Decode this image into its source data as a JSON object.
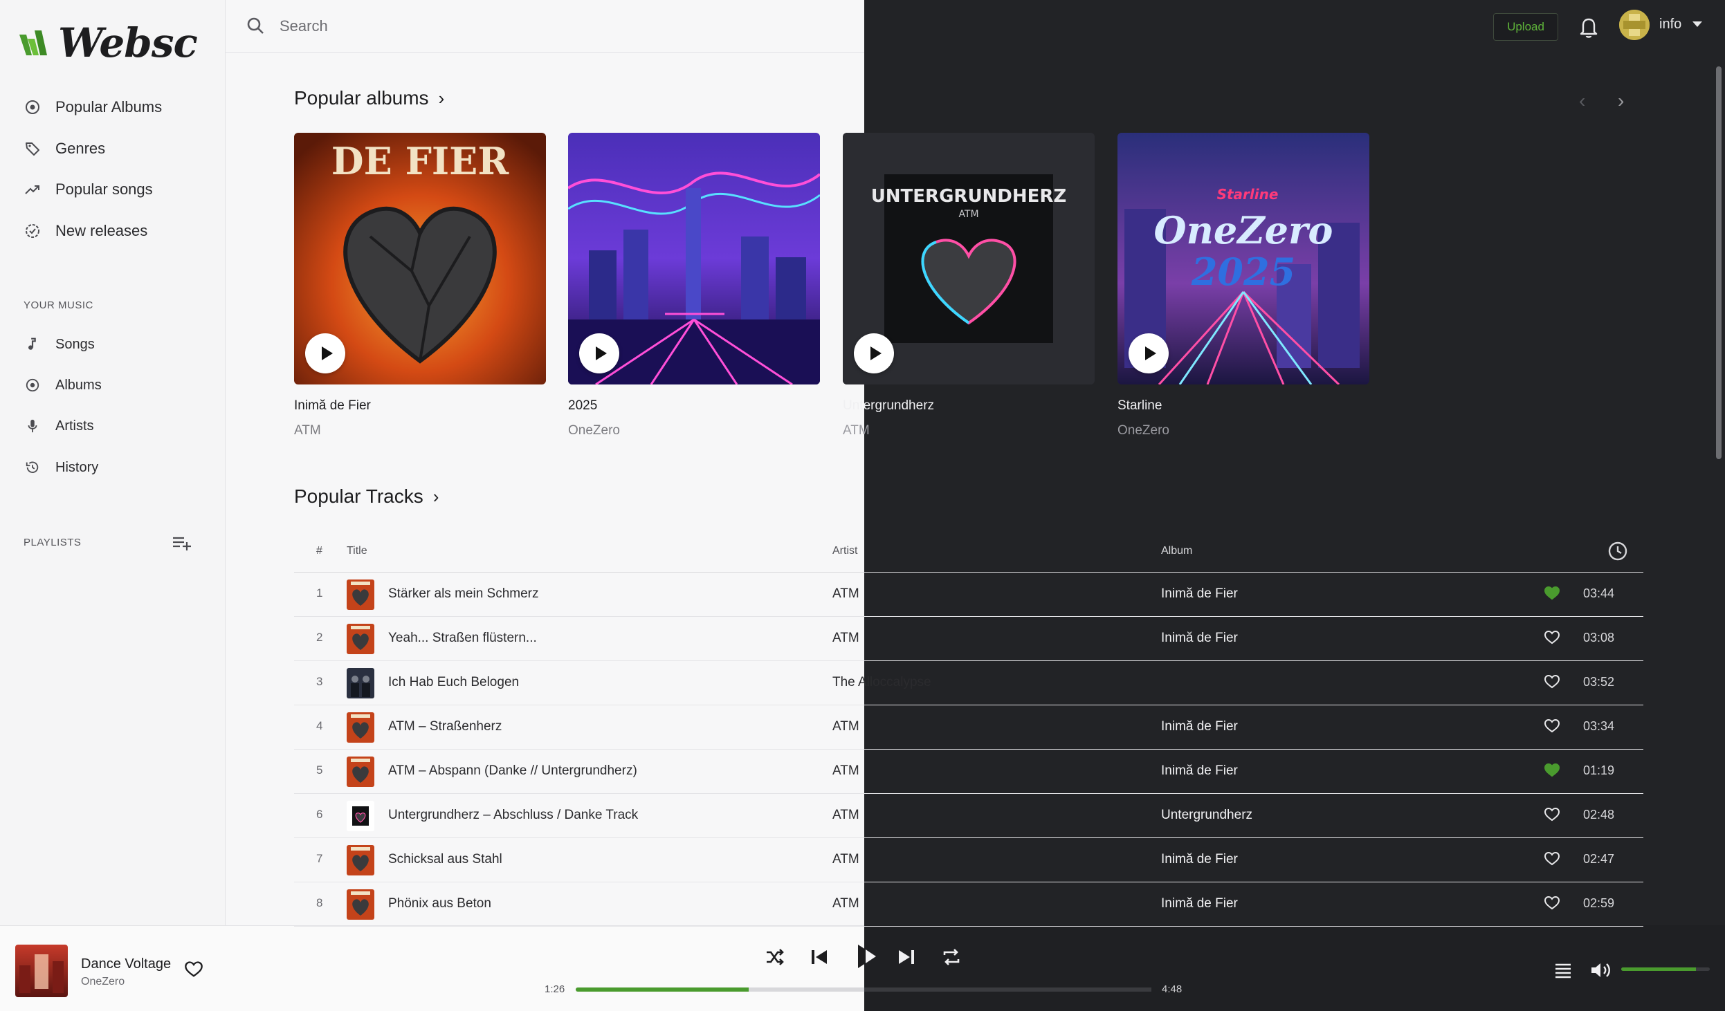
{
  "app": {
    "logo_text": "Websc"
  },
  "sidebar": {
    "main_items": [
      {
        "label": "Popular Albums",
        "icon": "disc-icon"
      },
      {
        "label": "Genres",
        "icon": "tag-icon"
      },
      {
        "label": "Popular songs",
        "icon": "trending-up-icon"
      },
      {
        "label": "New releases",
        "icon": "badge-icon"
      }
    ],
    "your_music_title": "YOUR MUSIC",
    "your_music_items": [
      {
        "label": "Songs",
        "icon": "music-note-icon"
      },
      {
        "label": "Albums",
        "icon": "disc-icon"
      },
      {
        "label": "Artists",
        "icon": "microphone-icon"
      },
      {
        "label": "History",
        "icon": "history-icon"
      }
    ],
    "playlists_title": "PLAYLISTS"
  },
  "topbar": {
    "search_placeholder": "Search",
    "upload_label": "Upload",
    "user_name": "info"
  },
  "popular_albums": {
    "heading": "Popular albums",
    "albums": [
      {
        "name": "Inimă de Fier",
        "artist": "ATM",
        "cover_text": "DE FIER"
      },
      {
        "name": "2025",
        "artist": "OneZero",
        "cover_text": ""
      },
      {
        "name": "Untergrundherz",
        "artist": "ATM",
        "cover_text": "UNTERGRUNDHERZ",
        "cover_subtext": "ATM"
      },
      {
        "name": "Starline",
        "artist": "OneZero",
        "cover_text": "OneZero",
        "cover_subtext": "2025",
        "cover_small": "Starline"
      }
    ]
  },
  "popular_tracks": {
    "heading": "Popular Tracks",
    "columns": {
      "num": "#",
      "title": "Title",
      "artist": "Artist",
      "album": "Album"
    },
    "rows": [
      {
        "num": "1",
        "title": "Stärker als mein Schmerz",
        "artist": "ATM",
        "album": "Inimă de Fier",
        "liked": true,
        "duration": "03:44",
        "thumb": "fire"
      },
      {
        "num": "2",
        "title": "Yeah... Straßen flüstern...",
        "artist": "ATM",
        "album": "Inimă de Fier",
        "liked": false,
        "duration": "03:08",
        "thumb": "fire"
      },
      {
        "num": "3",
        "title": "Ich Hab Euch Belogen",
        "artist": "The Alloccalypse",
        "album": "",
        "liked": false,
        "duration": "03:52",
        "thumb": "band"
      },
      {
        "num": "4",
        "title": "ATM – Straßenherz",
        "artist": "ATM",
        "album": "Inimă de Fier",
        "liked": false,
        "duration": "03:34",
        "thumb": "fire"
      },
      {
        "num": "5",
        "title": "ATM – Abspann (Danke // Untergrundherz)",
        "artist": "ATM",
        "album": "Inimă de Fier",
        "liked": true,
        "duration": "01:19",
        "thumb": "fire"
      },
      {
        "num": "6",
        "title": "Untergrundherz – Abschluss / Danke Track",
        "artist": "ATM",
        "album": "Untergrundherz",
        "liked": false,
        "duration": "02:48",
        "thumb": "neon"
      },
      {
        "num": "7",
        "title": "Schicksal aus Stahl",
        "artist": "ATM",
        "album": "Inimă de Fier",
        "liked": false,
        "duration": "02:47",
        "thumb": "fire"
      },
      {
        "num": "8",
        "title": "Phönix aus Beton",
        "artist": "ATM",
        "album": "Inimă de Fier",
        "liked": false,
        "duration": "02:59",
        "thumb": "fire"
      }
    ]
  },
  "player": {
    "title": "Dance Voltage",
    "artist": "OneZero",
    "current_time": "1:26",
    "total_time": "4:48",
    "progress": 0.3,
    "volume": 0.84
  },
  "colors": {
    "accent": "#4a9b2e",
    "dark_bg": "#222326",
    "light_bg": "#f7f7f8"
  }
}
